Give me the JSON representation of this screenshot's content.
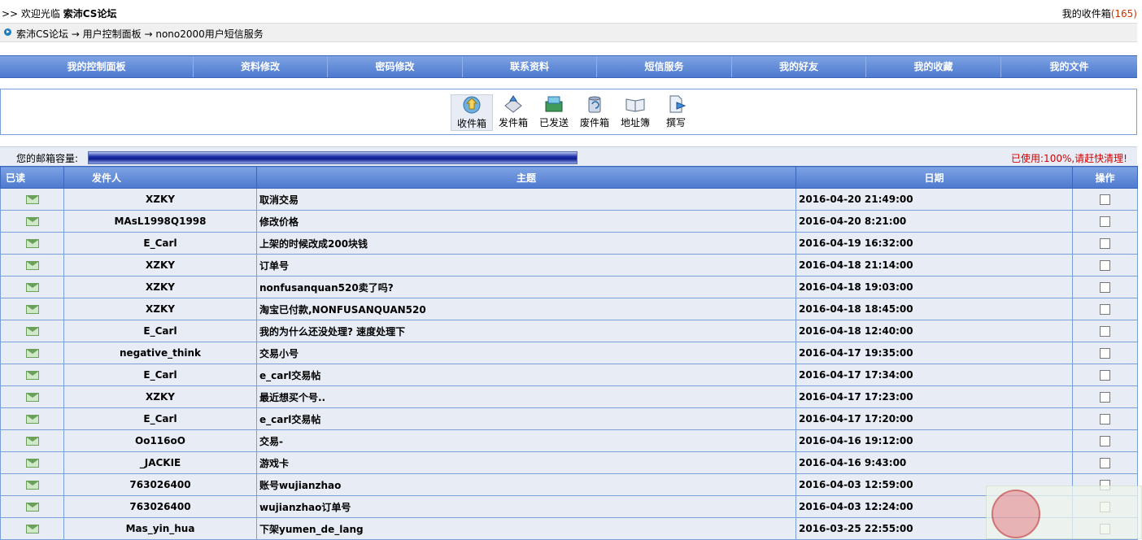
{
  "header": {
    "welcome_prefix": ">> 欢迎光临",
    "forum_name": "索沛CS论坛",
    "inbox_label": "我的收件箱",
    "inbox_count": "(165)"
  },
  "breadcrumb": {
    "path": "索沛CS论坛 → 用户控制面板 → nono2000用户短信服务"
  },
  "menu": {
    "items": [
      "我的控制面板",
      "资料修改",
      "密码修改",
      "联系资料",
      "短信服务",
      "我的好友",
      "我的收藏",
      "我的文件"
    ]
  },
  "tools": [
    {
      "label": "收件箱",
      "icon": "inbox-icon"
    },
    {
      "label": "发件箱",
      "icon": "outbox-icon"
    },
    {
      "label": "已发送",
      "icon": "sent-icon"
    },
    {
      "label": "废件箱",
      "icon": "trash-icon"
    },
    {
      "label": "地址簿",
      "icon": "address-book-icon"
    },
    {
      "label": "撰写",
      "icon": "compose-icon"
    }
  ],
  "quota": {
    "label": "您的邮箱容量:",
    "used_fraction": 1.0,
    "used_text": "已使用:100%,请赶快清理!"
  },
  "table": {
    "headers": {
      "read": "已读",
      "from": "发件人",
      "subject": "主题",
      "date": "日期",
      "action": "操作"
    },
    "rows": [
      {
        "from": "XZKY",
        "subject": "取消交易",
        "date": "2016-04-20 21:49:00"
      },
      {
        "from": "MAsL1998Q1998",
        "subject": "修改价格",
        "date": "2016-04-20 8:21:00"
      },
      {
        "from": "E_Carl",
        "subject": "上架的时候改成200块钱",
        "date": "2016-04-19 16:32:00"
      },
      {
        "from": "XZKY",
        "subject": "订单号",
        "date": "2016-04-18 21:14:00"
      },
      {
        "from": "XZKY",
        "subject": "nonfusanquan520卖了吗?",
        "date": "2016-04-18 19:03:00"
      },
      {
        "from": "XZKY",
        "subject": "淘宝已付款,NONFUSANQUAN520",
        "date": "2016-04-18 18:45:00"
      },
      {
        "from": "E_Carl",
        "subject": "我的为什么还没处理? 速度处理下",
        "date": "2016-04-18 12:40:00"
      },
      {
        "from": "negative_think",
        "subject": "交易小号",
        "date": "2016-04-17 19:35:00"
      },
      {
        "from": "E_Carl",
        "subject": "e_carl交易帖",
        "date": "2016-04-17 17:34:00"
      },
      {
        "from": "XZKY",
        "subject": "最近想买个号..",
        "date": "2016-04-17 17:23:00"
      },
      {
        "from": "E_Carl",
        "subject": "e_carl交易帖",
        "date": "2016-04-17 17:20:00"
      },
      {
        "from": "Oo116oO",
        "subject": "交易-",
        "date": "2016-04-16 19:12:00"
      },
      {
        "from": "_JACKIE",
        "subject": "游戏卡",
        "date": "2016-04-16 9:43:00"
      },
      {
        "from": "763026400",
        "subject": "账号wujianzhao",
        "date": "2016-04-03 12:59:00"
      },
      {
        "from": "763026400",
        "subject": "wujianzhao订单号",
        "date": "2016-04-03 12:24:00"
      },
      {
        "from": "Mas_yin_hua",
        "subject": "下架yumen_de_lang",
        "date": "2016-03-25 22:55:00"
      }
    ]
  }
}
